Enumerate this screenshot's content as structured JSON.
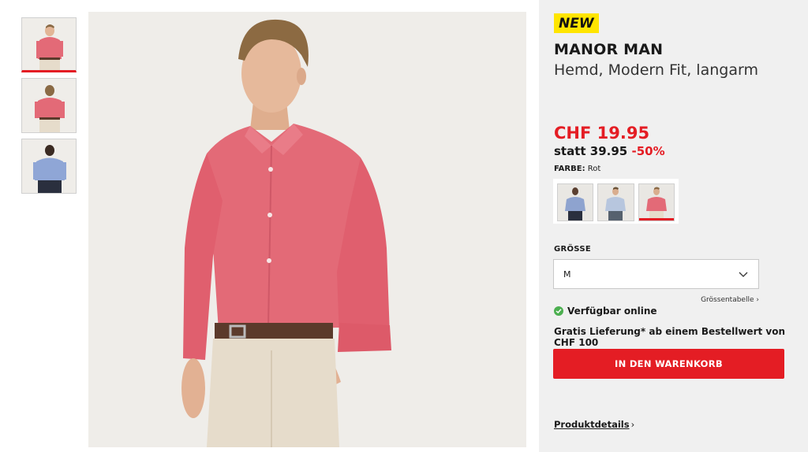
{
  "badge": {
    "label": "NEW"
  },
  "product": {
    "brand": "MANOR MAN",
    "title": "Hemd, Modern Fit, langarm",
    "price": "CHF 19.95",
    "old_price": "statt 39.95",
    "discount": "-50%"
  },
  "color": {
    "label": "FARBE:",
    "value": "Rot"
  },
  "thumbnails": [
    {
      "name": "thumb-front-red",
      "shirt": "#e36a77",
      "pants": "#e6dccb",
      "active": true
    },
    {
      "name": "thumb-back-red",
      "shirt": "#e36a77",
      "pants": "#e6dccb",
      "active": false
    },
    {
      "name": "thumb-back-blue",
      "shirt": "#8fa6d6",
      "pants": "#2a2f3e",
      "active": false
    }
  ],
  "swatches": [
    {
      "name": "swatch-blue-dark",
      "shirt": "#8ea3cf",
      "pants": "#2a2f3e",
      "active": false
    },
    {
      "name": "swatch-light-blue",
      "shirt": "#b7c6de",
      "pants": "#56616e",
      "active": false
    },
    {
      "name": "swatch-red",
      "shirt": "#e36a77",
      "pants": "#e6dccb",
      "active": true
    }
  ],
  "size": {
    "label": "GRÖSSE",
    "selected": "M",
    "table_link": "Grössentabelle"
  },
  "availability": {
    "text": "Verfügbar online"
  },
  "delivery": {
    "text": "Gratis Lieferung* ab einem Bestellwert von CHF 100"
  },
  "cart": {
    "label": "IN DEN WARENKORB"
  },
  "details": {
    "label": "Produktdetails"
  },
  "colors": {
    "accent": "#e41d24",
    "badge": "#ffe500",
    "panel": "#f0f0f0",
    "available": "#4caf50"
  },
  "icons": [
    "chevron-down-icon",
    "chevron-right-icon",
    "check-circle-icon"
  ]
}
